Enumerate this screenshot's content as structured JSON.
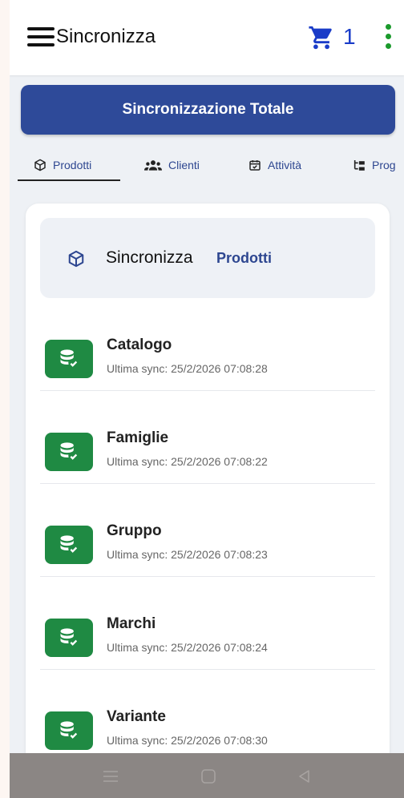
{
  "appbar": {
    "title": "Sincronizza",
    "cart_count": "1",
    "icons": [
      "hamburger-menu-icon",
      "cart-icon",
      "more-vert-icon"
    ]
  },
  "sync_all": {
    "label": "Sincronizzazione Totale"
  },
  "tabs": [
    {
      "label": "Prodotti",
      "icon": "cube-icon",
      "selected": true
    },
    {
      "label": "Clienti",
      "icon": "people-icon",
      "selected": false
    },
    {
      "label": "Attività",
      "icon": "calendar-check-icon",
      "selected": false
    },
    {
      "label": "Prog",
      "icon": "tree-icon",
      "selected": false
    }
  ],
  "card": {
    "header_prefix": "Sincronizza",
    "header_strong": "Prodotti",
    "items": [
      {
        "name": "Catalogo",
        "last_sync": "Ultima sync: 25/2/2026 07:08:28"
      },
      {
        "name": "Famiglie",
        "last_sync": "Ultima sync: 25/2/2026 07:08:22"
      },
      {
        "name": "Gruppo",
        "last_sync": "Ultima sync: 25/2/2026 07:08:23"
      },
      {
        "name": "Marchi",
        "last_sync": "Ultima sync: 25/2/2026 07:08:24"
      },
      {
        "name": "Variante",
        "last_sync": "Ultima sync: 25/2/2026 07:08:30"
      }
    ]
  },
  "colors": {
    "primary": "#2e4a99",
    "accent_blue": "#1a3cc8",
    "success_green": "#1f8a43",
    "more_green": "#1b9a2c"
  }
}
